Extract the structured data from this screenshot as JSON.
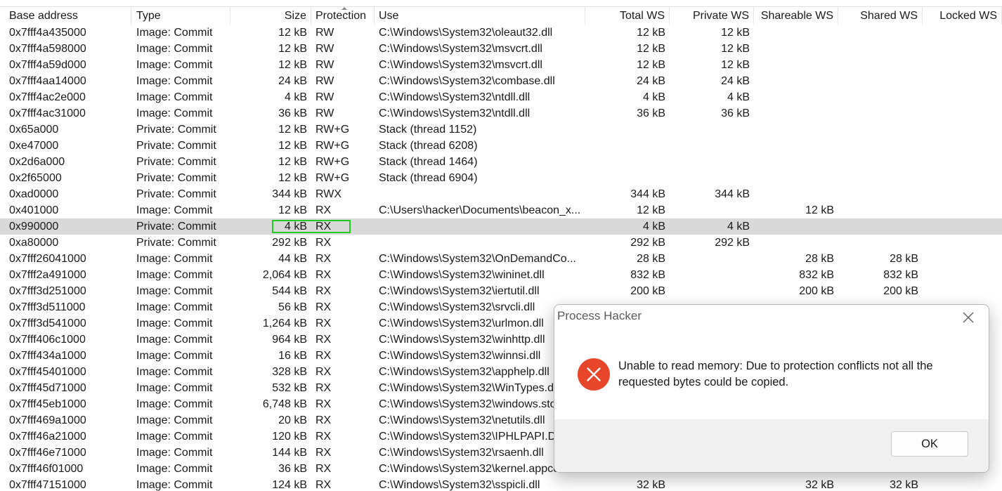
{
  "columns": [
    "Base address",
    "Type",
    "Size",
    "Protection",
    "Use",
    "Total WS",
    "Private WS",
    "Shareable WS",
    "Shared WS",
    "Locked WS"
  ],
  "rows": [
    [
      "0x7fff4a435000",
      "Image: Commit",
      "12 kB",
      "RW",
      "C:\\Windows\\System32\\oleaut32.dll",
      "12 kB",
      "12 kB",
      "",
      "",
      ""
    ],
    [
      "0x7fff4a598000",
      "Image: Commit",
      "12 kB",
      "RW",
      "C:\\Windows\\System32\\msvcrt.dll",
      "12 kB",
      "12 kB",
      "",
      "",
      ""
    ],
    [
      "0x7fff4a59d000",
      "Image: Commit",
      "12 kB",
      "RW",
      "C:\\Windows\\System32\\msvcrt.dll",
      "12 kB",
      "12 kB",
      "",
      "",
      ""
    ],
    [
      "0x7fff4aa14000",
      "Image: Commit",
      "24 kB",
      "RW",
      "C:\\Windows\\System32\\combase.dll",
      "24 kB",
      "24 kB",
      "",
      "",
      ""
    ],
    [
      "0x7fff4ac2e000",
      "Image: Commit",
      "4 kB",
      "RW",
      "C:\\Windows\\System32\\ntdll.dll",
      "4 kB",
      "4 kB",
      "",
      "",
      ""
    ],
    [
      "0x7fff4ac31000",
      "Image: Commit",
      "36 kB",
      "RW",
      "C:\\Windows\\System32\\ntdll.dll",
      "36 kB",
      "36 kB",
      "",
      "",
      ""
    ],
    [
      "0x65a000",
      "Private: Commit",
      "12 kB",
      "RW+G",
      "Stack (thread 1152)",
      "",
      "",
      "",
      "",
      ""
    ],
    [
      "0xe47000",
      "Private: Commit",
      "12 kB",
      "RW+G",
      "Stack (thread 6208)",
      "",
      "",
      "",
      "",
      ""
    ],
    [
      "0x2d6a000",
      "Private: Commit",
      "12 kB",
      "RW+G",
      "Stack (thread 1464)",
      "",
      "",
      "",
      "",
      ""
    ],
    [
      "0x2f65000",
      "Private: Commit",
      "12 kB",
      "RW+G",
      "Stack (thread 6904)",
      "",
      "",
      "",
      "",
      ""
    ],
    [
      "0xad0000",
      "Private: Commit",
      "344 kB",
      "RWX",
      "",
      "344 kB",
      "344 kB",
      "",
      "",
      ""
    ],
    [
      "0x401000",
      "Image: Commit",
      "12 kB",
      "RX",
      "C:\\Users\\hacker\\Documents\\beacon_x...",
      "12 kB",
      "",
      "12 kB",
      "",
      ""
    ],
    [
      "0x990000",
      "Private: Commit",
      "4 kB",
      "RX",
      "",
      "4 kB",
      "4 kB",
      "",
      "",
      ""
    ],
    [
      "0xa80000",
      "Private: Commit",
      "292 kB",
      "RX",
      "",
      "292 kB",
      "292 kB",
      "",
      "",
      ""
    ],
    [
      "0x7fff26041000",
      "Image: Commit",
      "44 kB",
      "RX",
      "C:\\Windows\\System32\\OnDemandCo...",
      "28 kB",
      "",
      "28 kB",
      "28 kB",
      ""
    ],
    [
      "0x7fff2a491000",
      "Image: Commit",
      "2,064 kB",
      "RX",
      "C:\\Windows\\System32\\wininet.dll",
      "832 kB",
      "",
      "832 kB",
      "832 kB",
      ""
    ],
    [
      "0x7fff3d251000",
      "Image: Commit",
      "544 kB",
      "RX",
      "C:\\Windows\\System32\\iertutil.dll",
      "200 kB",
      "",
      "200 kB",
      "200 kB",
      ""
    ],
    [
      "0x7fff3d511000",
      "Image: Commit",
      "56 kB",
      "RX",
      "C:\\Windows\\System32\\srvcli.dll",
      "",
      "",
      "",
      "",
      ""
    ],
    [
      "0x7fff3d541000",
      "Image: Commit",
      "1,264 kB",
      "RX",
      "C:\\Windows\\System32\\urlmon.dll",
      "",
      "",
      "",
      "",
      ""
    ],
    [
      "0x7fff406c1000",
      "Image: Commit",
      "964 kB",
      "RX",
      "C:\\Windows\\System32\\winhttp.dll",
      "",
      "",
      "",
      "",
      ""
    ],
    [
      "0x7fff434a1000",
      "Image: Commit",
      "16 kB",
      "RX",
      "C:\\Windows\\System32\\winnsi.dll",
      "",
      "",
      "",
      "",
      ""
    ],
    [
      "0x7fff45401000",
      "Image: Commit",
      "328 kB",
      "RX",
      "C:\\Windows\\System32\\apphelp.dll",
      "",
      "",
      "",
      "",
      ""
    ],
    [
      "0x7fff45d71000",
      "Image: Commit",
      "532 kB",
      "RX",
      "C:\\Windows\\System32\\WinTypes.d",
      "",
      "",
      "",
      "",
      ""
    ],
    [
      "0x7fff45eb1000",
      "Image: Commit",
      "6,748 kB",
      "RX",
      "C:\\Windows\\System32\\windows.sto",
      "",
      "",
      "",
      "",
      ""
    ],
    [
      "0x7fff469a1000",
      "Image: Commit",
      "20 kB",
      "RX",
      "C:\\Windows\\System32\\netutils.dll",
      "",
      "",
      "",
      "",
      ""
    ],
    [
      "0x7fff46a21000",
      "Image: Commit",
      "120 kB",
      "RX",
      "C:\\Windows\\System32\\IPHLPAPI.D",
      "",
      "",
      "",
      "",
      ""
    ],
    [
      "0x7fff46e71000",
      "Image: Commit",
      "144 kB",
      "RX",
      "C:\\Windows\\System32\\rsaenh.dll",
      "",
      "",
      "",
      "",
      ""
    ],
    [
      "0x7fff46f01000",
      "Image: Commit",
      "36 kB",
      "RX",
      "C:\\Windows\\System32\\kernel.appco",
      "",
      "",
      "",
      "",
      ""
    ],
    [
      "0x7fff47151000",
      "Image: Commit",
      "124 kB",
      "RX",
      "C:\\Windows\\System32\\sspicli.dll",
      "32 kB",
      "",
      "32 kB",
      "32 kB",
      ""
    ]
  ],
  "selected_row": 12,
  "highlight_color": "#22cc22",
  "dialog": {
    "title": "Process Hacker",
    "message": "Unable to read memory: Due to protection conflicts not all the requested bytes could be copied.",
    "ok_label": "OK",
    "icon": "error-icon",
    "icon_color": "#e8462b"
  }
}
